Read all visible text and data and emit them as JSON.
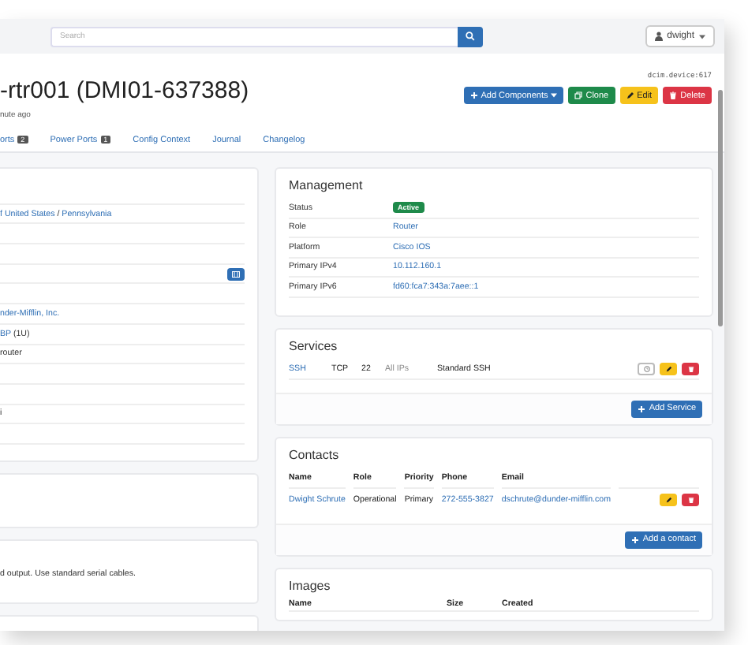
{
  "navbar": {
    "search": {
      "placeholder": "Search"
    },
    "user_menu": "dwight"
  },
  "header": {
    "title": "-rtr001 (DMI01-637388)",
    "subtitle": "nute ago",
    "object_id": "dcim.device:617",
    "buttons": [
      {
        "label": "Add Components",
        "kind": "primary",
        "caret": true
      },
      {
        "label": "Clone",
        "kind": "success",
        "caret": false
      },
      {
        "label": "Edit",
        "kind": "warning",
        "caret": false
      },
      {
        "label": "Delete",
        "kind": "danger",
        "caret": false
      }
    ]
  },
  "tabs": [
    {
      "label": "orts",
      "badge": "2"
    },
    {
      "label": "Power Ports",
      "badge": "1"
    },
    {
      "label": "Config Context"
    },
    {
      "label": "Journal"
    },
    {
      "label": "Changelog"
    }
  ],
  "device_card": {
    "rows": [
      {
        "kind": "empty"
      },
      {
        "kind": "links",
        "segments": [
          {
            "text": "f United States",
            "link": true
          },
          {
            "text": " / ",
            "link": false
          },
          {
            "text": "Pennsylvania",
            "link": true
          }
        ]
      },
      {
        "kind": "empty"
      },
      {
        "kind": "empty"
      },
      {
        "kind": "button"
      },
      {
        "kind": "empty"
      },
      {
        "kind": "links",
        "segments": [
          {
            "text": "nder-Mifflin, Inc.",
            "link": true
          }
        ]
      },
      {
        "kind": "links",
        "segments": [
          {
            "text": "BP",
            "link": true
          },
          {
            "text": " (1U)",
            "link": false
          }
        ]
      },
      {
        "kind": "links",
        "segments": [
          {
            "text": "router",
            "link": false
          }
        ]
      },
      {
        "kind": "empty"
      },
      {
        "kind": "empty"
      },
      {
        "kind": "links",
        "segments": [
          {
            "text": "i",
            "link": false
          }
        ]
      },
      {
        "kind": "empty"
      }
    ]
  },
  "comments_card": {
    "text": "d output. Use standard serial cables."
  },
  "management": {
    "title": "Management",
    "rows": [
      {
        "label": "Status",
        "value": "Active",
        "kind": "badge"
      },
      {
        "label": "Role",
        "value": "Router",
        "kind": "link"
      },
      {
        "label": "Platform",
        "value": "Cisco IOS",
        "kind": "link"
      },
      {
        "label": "Primary IPv4",
        "value": "10.112.160.1",
        "kind": "link"
      },
      {
        "label": "Primary IPv6",
        "value": "fd60:fca7:343a:7aee::1",
        "kind": "link"
      }
    ]
  },
  "services": {
    "title": "Services",
    "rows": [
      {
        "name": "SSH",
        "protocol": "TCP",
        "port": "22",
        "ips": "All IPs",
        "description": "Standard SSH"
      }
    ],
    "add_button": "Add Service"
  },
  "contacts": {
    "title": "Contacts",
    "columns": [
      "Name",
      "Role",
      "Priority",
      "Phone",
      "Email"
    ],
    "rows": [
      {
        "name": "Dwight Schrute",
        "role": "Operational",
        "priority": "Primary",
        "phone": "272-555-3827",
        "email": "dschrute@dunder-mifflin.com"
      }
    ],
    "add_button": "Add a contact"
  },
  "images": {
    "title": "Images",
    "columns": [
      "Name",
      "Size",
      "Created"
    ]
  }
}
